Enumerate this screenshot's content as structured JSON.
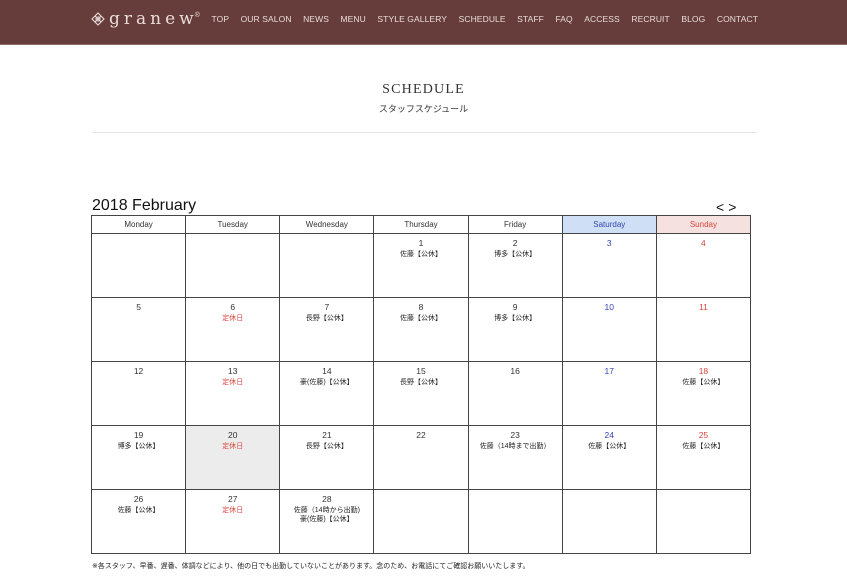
{
  "header": {
    "logo_text": "granew",
    "logo_sup": "®",
    "nav": [
      "TOP",
      "OUR SALON",
      "NEWS",
      "MENU",
      "STYLE GALLERY",
      "SCHEDULE",
      "STAFF",
      "FAQ",
      "ACCESS",
      "RECRUIT",
      "BLOG",
      "CONTACT"
    ]
  },
  "page": {
    "title_en": "SCHEDULE",
    "title_jp": "スタッフスケジュール"
  },
  "calendar": {
    "month_label": "2018 February",
    "prev": "<",
    "next": ">",
    "weekdays": [
      "Monday",
      "Tuesday",
      "Wednesday",
      "Thursday",
      "Friday",
      "Saturday",
      "Sunday"
    ],
    "weeks": [
      [
        {
          "day": ""
        },
        {
          "day": ""
        },
        {
          "day": ""
        },
        {
          "day": "1",
          "events": [
            "佐藤【公休】"
          ]
        },
        {
          "day": "2",
          "events": [
            "博多【公休】"
          ]
        },
        {
          "day": "3"
        },
        {
          "day": "4"
        }
      ],
      [
        {
          "day": "5"
        },
        {
          "day": "6",
          "closed": "定休日"
        },
        {
          "day": "7",
          "events": [
            "長野【公休】"
          ]
        },
        {
          "day": "8",
          "events": [
            "佐藤【公休】"
          ]
        },
        {
          "day": "9",
          "events": [
            "博多【公休】"
          ]
        },
        {
          "day": "10"
        },
        {
          "day": "11"
        }
      ],
      [
        {
          "day": "12"
        },
        {
          "day": "13",
          "closed": "定休日"
        },
        {
          "day": "14",
          "events": [
            "豪(佐藤)【公休】"
          ]
        },
        {
          "day": "15",
          "events": [
            "長野【公休】"
          ]
        },
        {
          "day": "16"
        },
        {
          "day": "17"
        },
        {
          "day": "18",
          "events": [
            "佐藤【公休】"
          ]
        }
      ],
      [
        {
          "day": "19",
          "events": [
            "博多【公休】"
          ]
        },
        {
          "day": "20",
          "closed": "定休日",
          "today": true
        },
        {
          "day": "21",
          "events": [
            "長野【公休】"
          ]
        },
        {
          "day": "22"
        },
        {
          "day": "23",
          "events": [
            "佐藤（14時まで出勤）"
          ]
        },
        {
          "day": "24",
          "events": [
            "佐藤【公休】"
          ]
        },
        {
          "day": "25",
          "events": [
            "佐藤【公休】"
          ]
        }
      ],
      [
        {
          "day": "26",
          "events": [
            "佐藤【公休】"
          ]
        },
        {
          "day": "27",
          "closed": "定休日"
        },
        {
          "day": "28",
          "events": [
            "佐藤（14時から出勤)",
            "豪(佐藤)【公休】"
          ]
        },
        {
          "day": ""
        },
        {
          "day": ""
        },
        {
          "day": ""
        },
        {
          "day": ""
        }
      ]
    ]
  },
  "footnote": "※各スタッフ、早番、遅番、体調などにより、他の日でも出勤していないことがあります。念のため、お電話にてご確認お願いいたします。",
  "colors": {
    "header_bg": "#663d3b",
    "saturday": "#3446b4",
    "sunday": "#d9443a",
    "saturday_bg": "#cfdff5",
    "sunday_bg": "#f5e1df",
    "today_bg": "#ececec"
  }
}
